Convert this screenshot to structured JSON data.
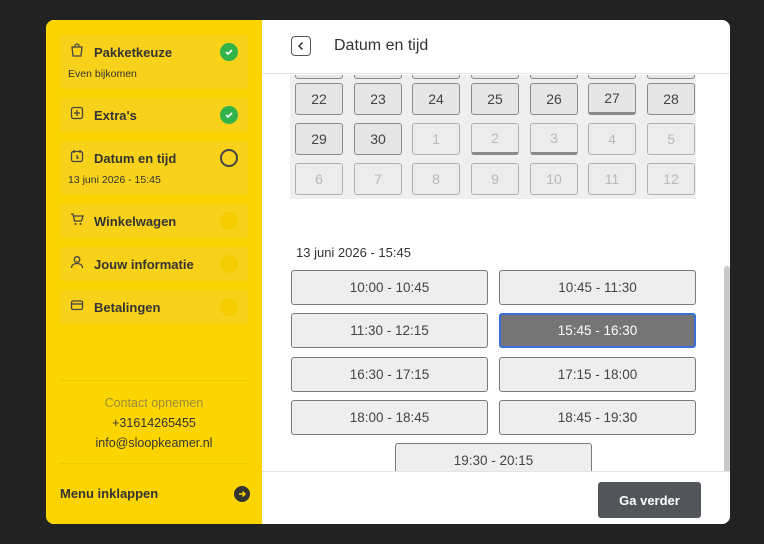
{
  "sidebar": {
    "steps": [
      {
        "label": "Pakketkeuze",
        "sub": "Even bijkomen",
        "status": "done"
      },
      {
        "label": "Extra's",
        "status": "done"
      },
      {
        "label": "Datum en tijd",
        "sub": "13 juni 2026 - 15:45",
        "status": "current"
      },
      {
        "label": "Winkelwagen",
        "status": "pending"
      },
      {
        "label": "Jouw informatie",
        "status": "pending"
      },
      {
        "label": "Betalingen",
        "status": "pending"
      }
    ],
    "contact": {
      "heading": "Contact opnemen",
      "phone": "+31614265455",
      "email": "info@sloopkeamer.nl"
    },
    "collapse_label": "Menu inklappen"
  },
  "header": {
    "title": "Datum en tijd"
  },
  "calendar": {
    "rows": [
      [
        {
          "day": "22"
        },
        {
          "day": "23"
        },
        {
          "day": "24"
        },
        {
          "day": "25"
        },
        {
          "day": "26"
        },
        {
          "day": "27",
          "marked": true
        },
        {
          "day": "28"
        }
      ],
      [
        {
          "day": "29"
        },
        {
          "day": "30"
        },
        {
          "day": "1",
          "disabled": true
        },
        {
          "day": "2",
          "disabled": true,
          "marked": true
        },
        {
          "day": "3",
          "disabled": true,
          "marked": true
        },
        {
          "day": "4",
          "disabled": true
        },
        {
          "day": "5",
          "disabled": true
        }
      ],
      [
        {
          "day": "6",
          "disabled": true
        },
        {
          "day": "7",
          "disabled": true
        },
        {
          "day": "8",
          "disabled": true
        },
        {
          "day": "9",
          "disabled": true
        },
        {
          "day": "10",
          "disabled": true
        },
        {
          "day": "11",
          "disabled": true
        },
        {
          "day": "12",
          "disabled": true
        }
      ]
    ]
  },
  "selected_datetime": "13 juni 2026 - 15:45",
  "time_slots": [
    {
      "label": "10:00 - 10:45"
    },
    {
      "label": "10:45 - 11:30"
    },
    {
      "label": "11:30 - 12:15"
    },
    {
      "label": "15:45 - 16:30",
      "selected": true
    },
    {
      "label": "16:30 - 17:15"
    },
    {
      "label": "17:15 - 18:00"
    },
    {
      "label": "18:00 - 18:45"
    },
    {
      "label": "18:45 - 19:30"
    },
    {
      "label": "19:30 - 20:15"
    }
  ],
  "footer": {
    "next_label": "Ga verder"
  },
  "colors": {
    "sidebar": "#fcd500",
    "done": "#32b34a",
    "active_slot": "#757575",
    "active_border": "#3a6fd8",
    "primary_button": "#52555a"
  }
}
